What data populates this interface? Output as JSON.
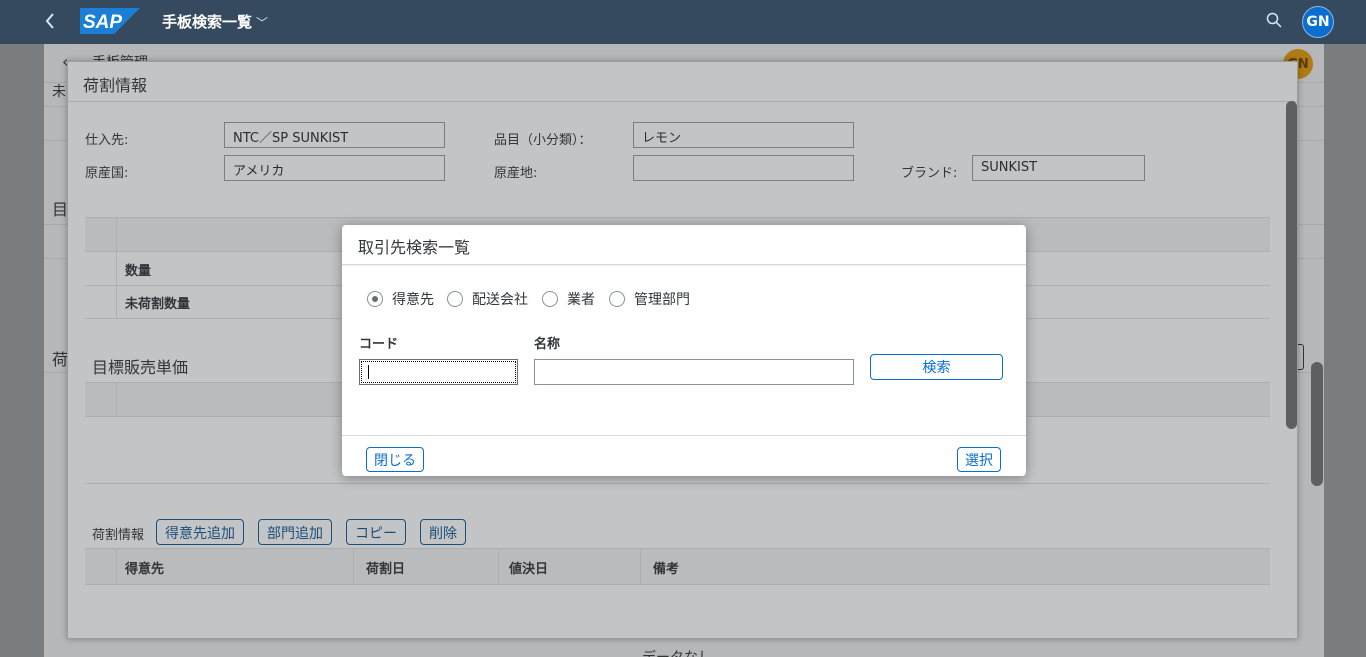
{
  "shell": {
    "title": "手板検索一覧",
    "logo": "SAP",
    "avatar": "GN",
    "icons": [
      "back-icon",
      "search-icon",
      "chevron-down-icon"
    ]
  },
  "background": {
    "title": "手板管理",
    "left_fragments": [
      "未",
      "目",
      "荷"
    ],
    "avatar": "GN",
    "footer_text": "データなし"
  },
  "outer_dialog": {
    "title": "荷割情報",
    "fields": {
      "supplier_label": "仕入先:",
      "supplier_value": "NTC／SP SUNKIST",
      "item_label": "品目（小分類）：",
      "item_value": "レモン",
      "origin_country_label": "原産国:",
      "origin_country_value": "アメリカ",
      "origin_place_label": "原産地:",
      "origin_place_value": "",
      "brand_label": "ブランド:",
      "brand_value": "SUNKIST"
    },
    "quantity_table": {
      "rows": [
        "数量",
        "未荷割数量"
      ]
    },
    "target_section_title": "目標販売単価",
    "allocation_toolbar": {
      "label": "荷割情報",
      "buttons": [
        "得意先追加",
        "部門追加",
        "コピー",
        "削除"
      ]
    },
    "allocation_table": {
      "columns": [
        "得意先",
        "荷割日",
        "値決日",
        "備考"
      ]
    }
  },
  "modal": {
    "title": "取引先検索一覧",
    "radio_options": [
      {
        "label": "得意先",
        "selected": true
      },
      {
        "label": "配送会社",
        "selected": false
      },
      {
        "label": "業者",
        "selected": false
      },
      {
        "label": "管理部門",
        "selected": false
      }
    ],
    "code_label": "コード",
    "code_value": "",
    "name_label": "名称",
    "name_value": "",
    "search_button": "検索",
    "close_button": "閉じる",
    "select_button": "選択"
  },
  "colors": {
    "shell": "#354a5f",
    "accent": "#0a6ed1",
    "avatar_bg": "#0a6ed1",
    "bg_avatar": "#b07a14"
  }
}
